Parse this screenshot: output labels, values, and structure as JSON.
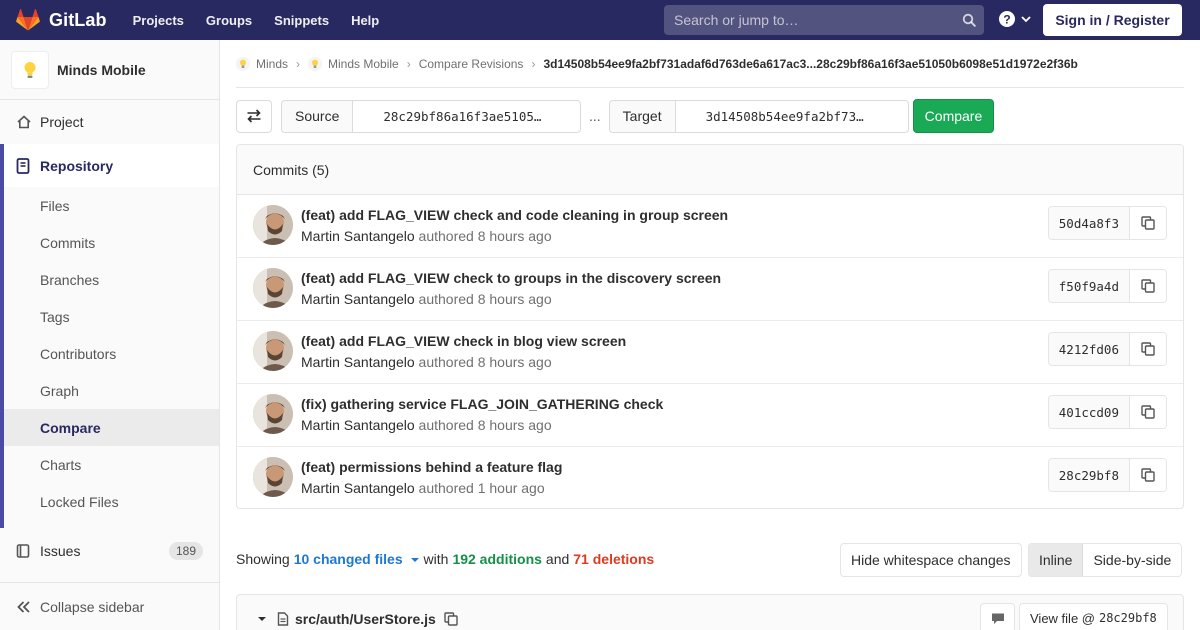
{
  "navbar": {
    "brand": "GitLab",
    "links": [
      "Projects",
      "Groups",
      "Snippets",
      "Help"
    ],
    "search_placeholder": "Search or jump to…",
    "signin_label": "Sign in / Register"
  },
  "sidebar": {
    "project_name": "Minds Mobile",
    "project_label": "Project",
    "repository_label": "Repository",
    "repo_items": [
      "Files",
      "Commits",
      "Branches",
      "Tags",
      "Contributors",
      "Graph",
      "Compare",
      "Charts",
      "Locked Files"
    ],
    "active_item": "Compare",
    "issues_label": "Issues",
    "issues_count": "189",
    "collapse_label": "Collapse sidebar"
  },
  "breadcrumb": {
    "items": [
      "Minds",
      "Minds Mobile",
      "Compare Revisions"
    ],
    "current": "3d14508b54ee9fa2bf731adaf6d763de6a617ac3...28c29bf86a16f3ae51050b6098e51d1972e2f36b"
  },
  "compare": {
    "source_label": "Source",
    "source_value": "28c29bf86a16f3ae5105…",
    "separator": "...",
    "target_label": "Target",
    "target_value": "3d14508b54ee9fa2bf73…",
    "button_label": "Compare"
  },
  "commits": {
    "header": "Commits (5)",
    "items": [
      {
        "title": "(feat) add FLAG_VIEW check and code cleaning in group screen",
        "author": "Martin Santangelo",
        "when": "authored 8 hours ago",
        "sha": "50d4a8f3"
      },
      {
        "title": "(feat) add FLAG_VIEW check to groups in the discovery screen",
        "author": "Martin Santangelo",
        "when": "authored 8 hours ago",
        "sha": "f50f9a4d"
      },
      {
        "title": "(feat) add FLAG_VIEW check in blog view screen",
        "author": "Martin Santangelo",
        "when": "authored 8 hours ago",
        "sha": "4212fd06"
      },
      {
        "title": "(fix) gathering service FLAG_JOIN_GATHERING check",
        "author": "Martin Santangelo",
        "when": "authored 8 hours ago",
        "sha": "401ccd09"
      },
      {
        "title": "(feat) permissions behind a feature flag",
        "author": "Martin Santangelo",
        "when": "authored 1 hour ago",
        "sha": "28c29bf8"
      }
    ]
  },
  "diff_stats": {
    "showing": "Showing",
    "files": "10 changed files",
    "with": "with",
    "additions": "192 additions",
    "and": "and",
    "deletions": "71 deletions"
  },
  "diff_options": {
    "whitespace_label": "Hide whitespace changes",
    "inline_label": "Inline",
    "side_label": "Side-by-side"
  },
  "file": {
    "path": "src/auth/UserStore.js",
    "view_label": "View file @",
    "view_sha": "28c29bf8"
  },
  "colors": {
    "navbar": "#292961",
    "compare_button": "#1aaa55",
    "additions": "#168f48",
    "deletions": "#db3b21",
    "link": "#1f78d1"
  }
}
